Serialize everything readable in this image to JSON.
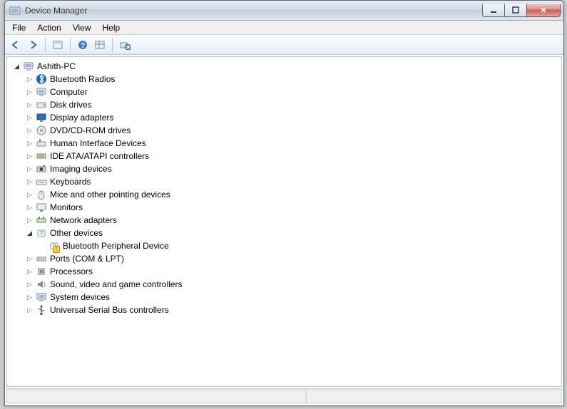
{
  "window": {
    "title": "Device Manager"
  },
  "menubar": [
    "File",
    "Action",
    "View",
    "Help"
  ],
  "toolbar": {
    "back": "←",
    "forward": "→"
  },
  "tree": {
    "root": {
      "label": "Ashith-PC",
      "expanded": true,
      "icon": "computer",
      "children": [
        {
          "label": "Bluetooth Radios",
          "icon": "bluetooth",
          "expandable": true
        },
        {
          "label": "Computer",
          "icon": "computer",
          "expandable": true
        },
        {
          "label": "Disk drives",
          "icon": "disk",
          "expandable": true
        },
        {
          "label": "Display adapters",
          "icon": "display",
          "expandable": true
        },
        {
          "label": "DVD/CD-ROM drives",
          "icon": "cdrom",
          "expandable": true
        },
        {
          "label": "Human Interface Devices",
          "icon": "hid",
          "expandable": true
        },
        {
          "label": "IDE ATA/ATAPI controllers",
          "icon": "ide",
          "expandable": true
        },
        {
          "label": "Imaging devices",
          "icon": "imaging",
          "expandable": true
        },
        {
          "label": "Keyboards",
          "icon": "keyboard",
          "expandable": true
        },
        {
          "label": "Mice and other pointing devices",
          "icon": "mouse",
          "expandable": true
        },
        {
          "label": "Monitors",
          "icon": "monitor",
          "expandable": true
        },
        {
          "label": "Network adapters",
          "icon": "network",
          "expandable": true
        },
        {
          "label": "Other devices",
          "icon": "other",
          "expandable": true,
          "expanded": true,
          "children": [
            {
              "label": "Bluetooth Peripheral Device",
              "icon": "other-warn",
              "expandable": false
            }
          ]
        },
        {
          "label": "Ports (COM & LPT)",
          "icon": "port",
          "expandable": true
        },
        {
          "label": "Processors",
          "icon": "cpu",
          "expandable": true
        },
        {
          "label": "Sound, video and game controllers",
          "icon": "sound",
          "expandable": true
        },
        {
          "label": "System devices",
          "icon": "system",
          "expandable": true
        },
        {
          "label": "Universal Serial Bus controllers",
          "icon": "usb",
          "expandable": true
        }
      ]
    }
  }
}
